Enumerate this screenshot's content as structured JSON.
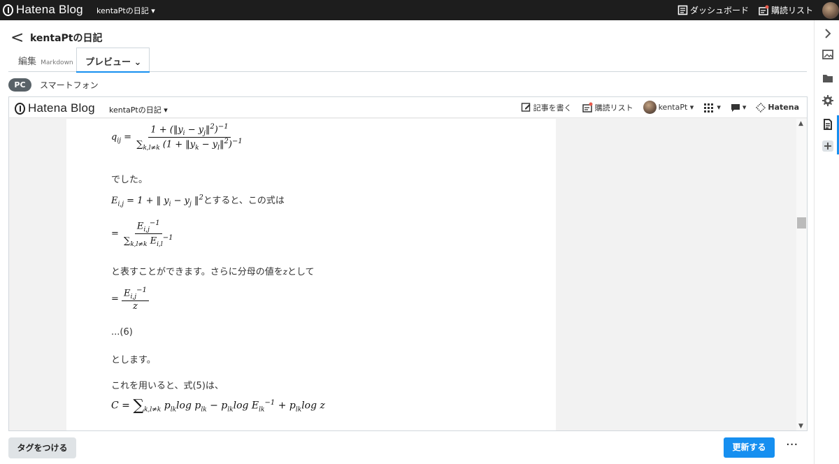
{
  "topbar": {
    "brand": "Hatena Blog",
    "blog_menu": "kentaPtの日記 ▾",
    "dashboard": "ダッシュボード",
    "reading_list": "購読リスト"
  },
  "editor": {
    "back_label": "<",
    "title": "kentaPtの日記",
    "edit_tab": "編集",
    "edit_mode": "Markdown",
    "preview_tab": "プレビュー",
    "preview_chevron": "⌄",
    "pc_label": "PC",
    "smartphone_label": "スマートフォン"
  },
  "preview": {
    "brand": "Hatena Blog",
    "blog_menu": "kentaPtの日記 ▾",
    "write_article": "記事を書く",
    "reading_list": "購読リスト",
    "username": "kentaPt ▾",
    "hatena": "Hatena"
  },
  "article": {
    "formula_1_left": "q",
    "formula_1_sub": "ij",
    "formula_1_equals": "=",
    "formula_1_numerator": "1 + (‖y",
    "formula_1_numerator_sub_i": "i",
    "formula_1_numerator_mid": " − y",
    "formula_1_numerator_sub_j": "j",
    "formula_1_numerator_end": "‖",
    "formula_1_numerator_sq": "2",
    "formula_1_numerator_close": ")",
    "formula_1_numerator_power": "−1",
    "formula_1_sum": "∑",
    "formula_1_sum_sub": "k,l≠k",
    "formula_1_denominator": " (1 + ‖y",
    "formula_1_den_sub_k": "k",
    "formula_1_den_mid": " − y",
    "formula_1_den_sub_l": "l",
    "formula_1_den_end": "‖",
    "formula_1_den_sq": "2",
    "formula_1_den_close": ")",
    "formula_1_den_power": "−1",
    "text_1": "でした。",
    "text_2_math_left": "E",
    "text_2_sub": "i,j",
    "text_2_math": " = 1 + ‖ y",
    "text_2_sub_i": "i",
    "text_2_math_mid": " − y",
    "text_2_sub_j": "j",
    "text_2_math_end": " ‖",
    "text_2_sq": "2",
    "text_2_rest": "とすると、この式は",
    "formula_2_equals": "=",
    "formula_2_num": "E",
    "formula_2_num_sub": "i,j",
    "formula_2_num_power": "−1",
    "formula_2_sum": "∑",
    "formula_2_sum_sub": "k,l≠k",
    "formula_2_den": " E",
    "formula_2_den_sub": "i,l",
    "formula_2_den_power": "−1",
    "text_3_before": "と表すことができます。さらに分母の値を",
    "text_3_var": "z",
    "text_3_after": "として",
    "formula_3_equals": "=",
    "formula_3_num": "E",
    "formula_3_num_sub": "i,j",
    "formula_3_num_power": "−1",
    "formula_3_den": "z",
    "text_4": "...(6)",
    "text_5": "とします。",
    "text_6": "これを用いると、式(5)は、",
    "formula_4_left": "C",
    "formula_4_equals": "=",
    "formula_4_sum": "∑",
    "formula_4_sum_sub": "k,l≠k",
    "formula_4_term_1": "p",
    "formula_4_term_1_sub": "lk",
    "formula_4_log_1": "log",
    "formula_4_term_2": " p",
    "formula_4_term_2_sub": "lk",
    "formula_4_minus": " − p",
    "formula_4_term_3_sub": "lk",
    "formula_4_log_2": "log",
    "formula_4_term_4": " E",
    "formula_4_term_4_sub": "lk",
    "formula_4_term_4_power": "−1",
    "formula_4_plus": " + p",
    "formula_4_term_5_sub": "lk",
    "formula_4_log_3": "log",
    "formula_4_z": " z"
  },
  "buttons": {
    "tag": "タグをつける",
    "update": "更新する",
    "more": "···"
  }
}
